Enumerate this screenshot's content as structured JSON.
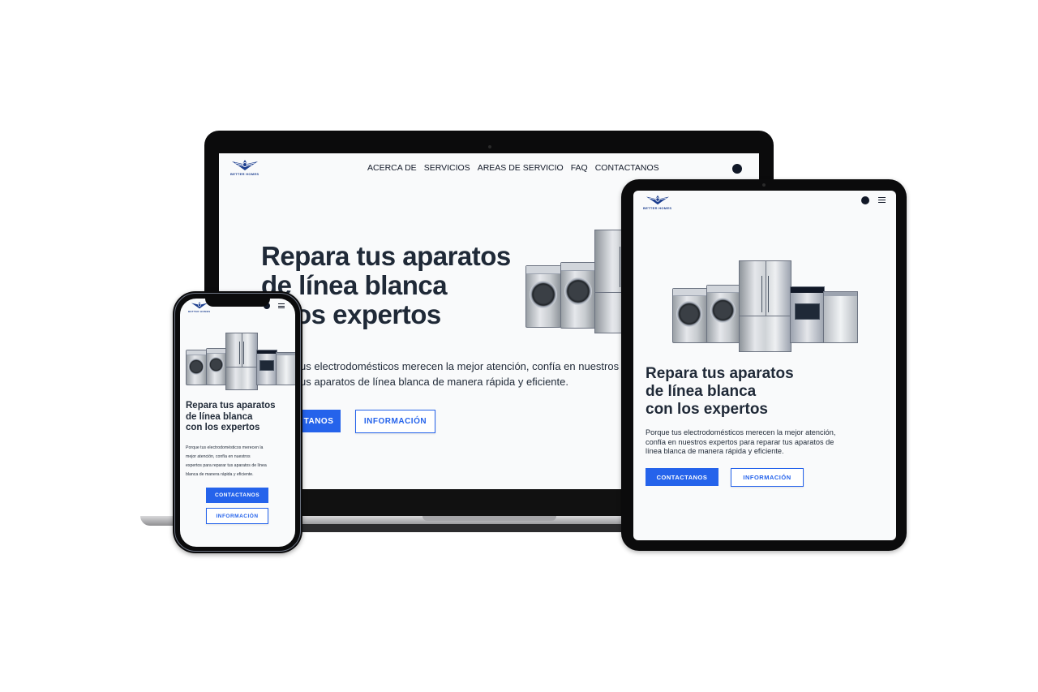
{
  "site": {
    "logo_text": "BETTER HOMES",
    "nav": [
      "ACERCA DE",
      "SERVICIOS",
      "AREAS DE SERVICIO",
      "FAQ",
      "CONTACTANOS"
    ],
    "hero_title_lines": [
      "Repara tus aparatos",
      "de línea blanca",
      "con los expertos"
    ],
    "hero_text": "Porque tus electrodomésticos merecen la mejor atención, confía en nuestros expertos para reparar tus aparatos de línea blanca de manera rápida y eficiente.",
    "hero_text_lines": [
      "Porque tus electrodomésticos merecen la mejor atención,",
      "confía en nuestros expertos para reparar tus aparatos de",
      "línea blanca de manera rápida y eficiente."
    ],
    "laptop_visible_title": [
      "Repara tus aparatos",
      "de línea blanca",
      "n los expertos"
    ],
    "laptop_visible_text": [
      "us electrodomésticos merecen la mejor atención, confía en nuestros",
      "us aparatos de línea blanca de manera rápida y eficiente."
    ],
    "laptop_cta_visible": "TANOS",
    "cta_primary": "CONTACTANOS",
    "cta_secondary": "INFORMACIÓN",
    "phone_text_lines": [
      "Porque tus electrodomésticos merecen la",
      "mejor atención, confía en nuestros",
      "expertos para reparar tus aparatos de línea",
      "blanca de manera rápida y eficiente."
    ],
    "icons": {
      "theme_toggle": "moon-icon",
      "menu": "hamburger-menu-icon",
      "logo": "wing-logo-icon"
    },
    "colors": {
      "accent": "#2563eb",
      "title": "#1f2937",
      "background": "#f9fafb",
      "logo": "#1d3f8f"
    }
  }
}
